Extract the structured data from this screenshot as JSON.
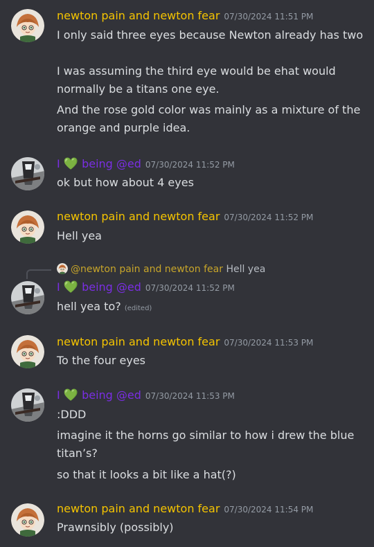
{
  "colors": {
    "background": "#323339",
    "newton_name": "#f5c400",
    "ed_name": "#7a2ee3",
    "heart": "#2fcc4c",
    "timestamp": "#949ba4",
    "text": "#dbdee1"
  },
  "messages": [
    {
      "author": "newton pain and newton fear",
      "timestamp": "07/30/2024 11:51 PM",
      "lines": [
        "I only said three eyes because Newton already has two",
        "",
        "I was assuming the third eye would be ehat would",
        "normally be a titans one eye."
      ],
      "followup_lines": [
        "And the rose gold color was mainly as a mixture of the",
        "orange and purple idea."
      ]
    },
    {
      "author_prefix": "I",
      "author_heart": "💚",
      "author_suffix": "being @ed",
      "timestamp": "07/30/2024 11:52 PM",
      "lines": [
        "ok but how about 4 eyes"
      ]
    },
    {
      "author": "newton pain and newton fear",
      "timestamp": "07/30/2024 11:52 PM",
      "lines": [
        "Hell yea"
      ]
    },
    {
      "reply": {
        "name": "@newton pain and newton fear",
        "text": "Hell yea"
      },
      "author_prefix": "I",
      "author_heart": "💚",
      "author_suffix": "being @ed",
      "timestamp": "07/30/2024 11:52 PM",
      "lines": [
        "hell yea to?"
      ],
      "edited": "(edited)"
    },
    {
      "author": "newton pain and newton fear",
      "timestamp": "07/30/2024 11:53 PM",
      "lines": [
        "To the four eyes"
      ]
    },
    {
      "author_prefix": "I",
      "author_heart": "💚",
      "author_suffix": "being @ed",
      "timestamp": "07/30/2024 11:53 PM",
      "lines": [
        ":DDD"
      ],
      "followup_lines": [
        "imagine it the horns go similar to how i drew the blue",
        "titan’s?"
      ],
      "followup_lines_2": [
        "so that it looks a bit like a hat(?)"
      ]
    },
    {
      "author": "newton pain and newton fear",
      "timestamp": "07/30/2024 11:54 PM",
      "lines": [
        "Prawnsibly (possibly)"
      ]
    }
  ]
}
